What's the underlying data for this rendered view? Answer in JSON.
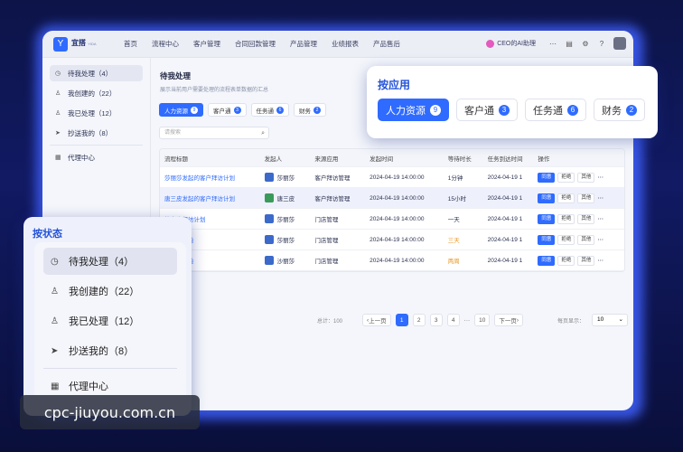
{
  "brand": {
    "name": "宜搭",
    "sub": "YIDA"
  },
  "nav": [
    "首页",
    "流程中心",
    "客户管理",
    "合同回款管理",
    "产品管理",
    "业绩报表",
    "产品售后"
  ],
  "topright": {
    "ai": "CEO的AI助理"
  },
  "sidebar": {
    "items": [
      {
        "label": "待我处理（4）",
        "icon": "clock-icon"
      },
      {
        "label": "我创建的（22）",
        "icon": "user-icon"
      },
      {
        "label": "我已处理（12）",
        "icon": "user-check-icon"
      },
      {
        "label": "抄送我的（8）",
        "icon": "send-icon"
      }
    ],
    "agent": "代理中心"
  },
  "main": {
    "title": "待我处理",
    "subtitle": "展示当前用户需要处理的流程表单数据的汇总",
    "tabs": [
      {
        "label": "人力资源",
        "count": "9"
      },
      {
        "label": "客户通",
        "count": "3"
      },
      {
        "label": "任务通",
        "count": "6"
      },
      {
        "label": "财务",
        "count": "2"
      }
    ],
    "search_placeholder": "请搜索",
    "columns": [
      "流程标题",
      "发起人",
      "来源应用",
      "发起时间",
      "等待时长",
      "任务到达时间",
      "操作"
    ],
    "rows": [
      {
        "title": "莎丽莎发起的客户拜访计划",
        "user": "莎丽莎",
        "app": "客户拜访管理",
        "time": "2024-04-19 14:00:00",
        "wait": "1分钟",
        "arrive": "2024-04-19 1"
      },
      {
        "title": "唐三皮发起的客户拜访计划",
        "user": "唐三皮",
        "app": "客户拜访管理",
        "time": "2024-04-19 14:00:00",
        "wait": "15小时",
        "arrive": "2024-04-19 1"
      },
      {
        "title": "的客户拜访计划",
        "user": "莎丽莎",
        "app": "门店管理",
        "time": "2024-04-19 14:00:00",
        "wait": "一天",
        "arrive": "2024-04-19 1"
      },
      {
        "title": "的门店巡检",
        "user": "莎丽莎",
        "app": "门店管理",
        "time": "2024-04-19 14:00:00",
        "wait": "三天",
        "arrive": "2024-04-19 1"
      },
      {
        "title": "的门店巡检",
        "user": "沙丽莎",
        "app": "门店管理",
        "time": "2024-04-19 14:00:00",
        "wait": "两周",
        "arrive": "2024-04-19 1"
      }
    ],
    "actions": {
      "approve": "同意",
      "reject": "拒绝",
      "other": "其他"
    },
    "pager": {
      "total": "总计：100",
      "prev": "上一页",
      "pages": [
        "1",
        "2",
        "3",
        "4",
        "···",
        "10"
      ],
      "next": "下一页",
      "per": "每页显示：",
      "per_value": "10"
    }
  },
  "app_card": {
    "title": "按应用",
    "tabs": [
      {
        "label": "人力资源",
        "count": "9"
      },
      {
        "label": "客户通",
        "count": "3"
      },
      {
        "label": "任务通",
        "count": "6"
      },
      {
        "label": "财务",
        "count": "2"
      }
    ]
  },
  "state_card": {
    "title": "按状态",
    "items": [
      {
        "label": "待我处理（4）",
        "icon": "clock-icon"
      },
      {
        "label": "我创建的（22）",
        "icon": "user-icon"
      },
      {
        "label": "我已处理（12）",
        "icon": "user-check-icon"
      },
      {
        "label": "抄送我的（8）",
        "icon": "send-icon"
      }
    ],
    "agent": "代理中心"
  },
  "watermark": "cpc-jiuyou.com.cn",
  "colors": {
    "accent": "#2f6bff",
    "heading": "#2453d8",
    "warn": "#e89a2a"
  }
}
